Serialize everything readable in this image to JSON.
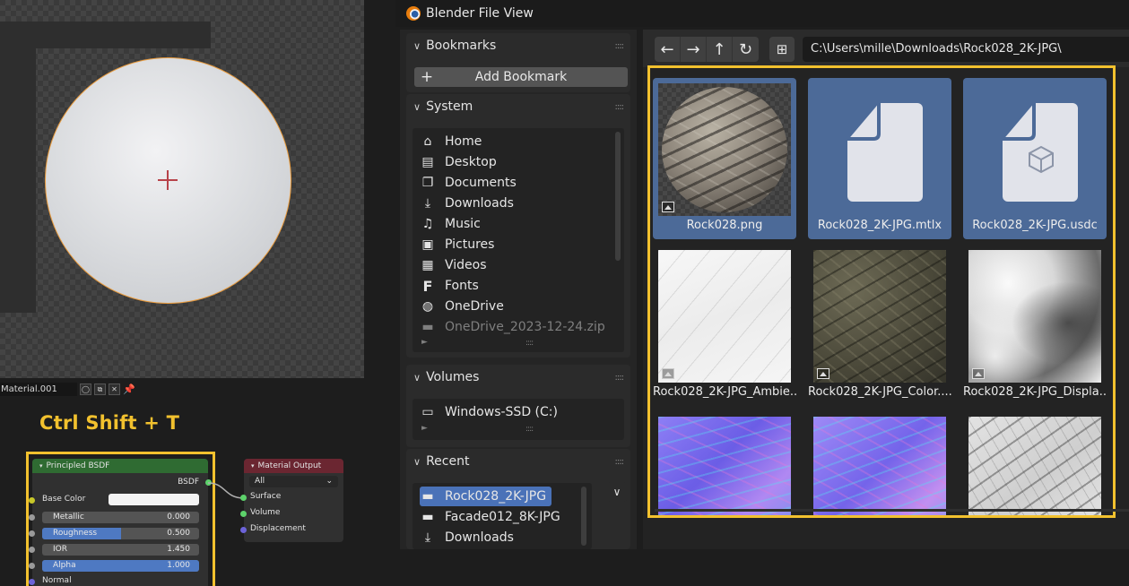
{
  "viewport": {},
  "node_editor": {
    "material_name": "Material.001",
    "shortcut_caption": "Ctrl Shift + T",
    "bsdf_node": {
      "title": "Principled BSDF",
      "output_label": "BSDF",
      "base_color_label": "Base Color",
      "fields": [
        {
          "label": "Metallic",
          "value": "0.000",
          "fill": 0.0
        },
        {
          "label": "Roughness",
          "value": "0.500",
          "fill": 0.5
        },
        {
          "label": "IOR",
          "value": "1.450",
          "fill": 0.0
        },
        {
          "label": "Alpha",
          "value": "1.000",
          "fill": 1.0
        }
      ],
      "normal_label": "Normal"
    },
    "output_node": {
      "title": "Material Output",
      "target": "All",
      "sockets": [
        "Surface",
        "Volume",
        "Displacement"
      ]
    }
  },
  "file_view": {
    "window_title": "Blender File View",
    "bookmarks": {
      "title": "Bookmarks",
      "add_label": "Add Bookmark"
    },
    "system": {
      "title": "System",
      "items": [
        {
          "label": "Home",
          "icon": "home-icon"
        },
        {
          "label": "Desktop",
          "icon": "desktop-icon"
        },
        {
          "label": "Documents",
          "icon": "documents-icon"
        },
        {
          "label": "Downloads",
          "icon": "download-icon"
        },
        {
          "label": "Music",
          "icon": "music-icon"
        },
        {
          "label": "Pictures",
          "icon": "pictures-icon"
        },
        {
          "label": "Videos",
          "icon": "videos-icon"
        },
        {
          "label": "Fonts",
          "icon": "fonts-icon"
        },
        {
          "label": "OneDrive",
          "icon": "globe-icon"
        },
        {
          "label": "OneDrive_2023-12-24.zip",
          "icon": "folder-icon"
        }
      ]
    },
    "volumes": {
      "title": "Volumes",
      "items": [
        {
          "label": "Windows-SSD (C:)",
          "icon": "drive-icon"
        }
      ]
    },
    "recent": {
      "title": "Recent",
      "items": [
        {
          "label": "Rock028_2K-JPG",
          "icon": "folder-icon"
        },
        {
          "label": "Facade012_8K-JPG",
          "icon": "folder-icon"
        },
        {
          "label": "Downloads",
          "icon": "download-icon"
        }
      ]
    },
    "path": "C:\\Users\\mille\\Downloads\\Rock028_2K-JPG\\",
    "files": [
      {
        "name": "Rock028.png",
        "selected": true
      },
      {
        "name": "Rock028_2K-JPG.mtlx",
        "selected": true
      },
      {
        "name": "Rock028_2K-JPG.usdc",
        "selected": true
      },
      {
        "name": "Rock028_2K-JPG_Ambie...",
        "selected": false
      },
      {
        "name": "Rock028_2K-JPG_Color....",
        "selected": false
      },
      {
        "name": "Rock028_2K-JPG_Displa...",
        "selected": false
      },
      {
        "name": "",
        "selected": false
      },
      {
        "name": "",
        "selected": false
      },
      {
        "name": "",
        "selected": false
      }
    ],
    "colors": {
      "accent_yellow": "#f2c12e",
      "selection_blue": "#4c6a98",
      "list_select": "#4a72b8"
    }
  }
}
